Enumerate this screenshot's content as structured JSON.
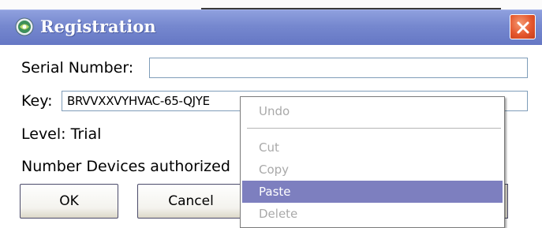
{
  "window": {
    "title": "Registration",
    "close_symbol": "✕"
  },
  "form": {
    "serial_label": "Serial Number:",
    "serial_value": "",
    "key_label": "Key:",
    "key_value": "BRVVXXVYHVAC-65-QJYE",
    "level_text": "Level: Trial",
    "devices_label": "Number Devices authorized"
  },
  "buttons": {
    "ok_label": "OK",
    "cancel_label": "Cancel"
  },
  "context_menu": {
    "items": [
      {
        "label": "Undo",
        "enabled": false
      },
      {
        "label": "Cut",
        "enabled": false
      },
      {
        "label": "Copy",
        "enabled": false
      },
      {
        "label": "Paste",
        "enabled": true,
        "highlighted": true
      },
      {
        "label": "Delete",
        "enabled": false
      }
    ],
    "highlight_color": "#7d7fbf"
  },
  "icons": [
    "app-icon",
    "close-icon"
  ]
}
